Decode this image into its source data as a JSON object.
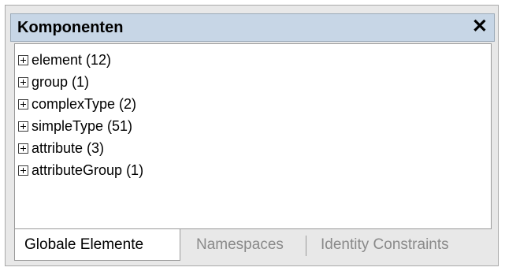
{
  "panel": {
    "title": "Komponenten",
    "close_symbol": "✕"
  },
  "tree": {
    "items": [
      {
        "label": "element (12)",
        "icon": "plus-box-icon"
      },
      {
        "label": "group (1)",
        "icon": "plus-box-icon"
      },
      {
        "label": "complexType (2)",
        "icon": "plus-box-icon"
      },
      {
        "label": "simpleType (51)",
        "icon": "plus-box-icon"
      },
      {
        "label": "attribute (3)",
        "icon": "plus-box-icon"
      },
      {
        "label": "attributeGroup (1)",
        "icon": "plus-box-icon"
      }
    ]
  },
  "tabs": [
    {
      "label": "Globale Elemente",
      "active": true
    },
    {
      "label": "Namespaces",
      "active": false
    },
    {
      "label": "Identity Constraints",
      "active": false
    }
  ],
  "colors": {
    "titlebar": "#c7d6e6",
    "frame": "#e8e8e8",
    "inactive_tab_text": "#8a8a8a"
  }
}
